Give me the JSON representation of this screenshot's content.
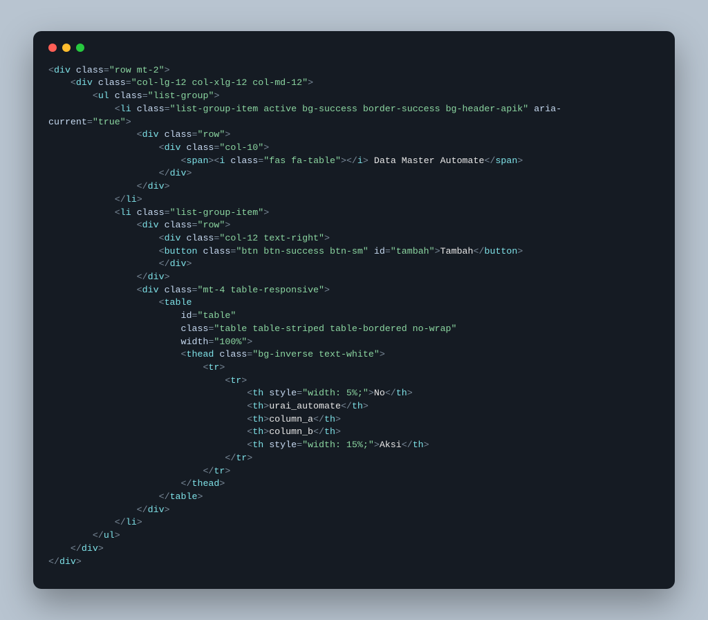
{
  "tokens": [
    {
      "indent": 0,
      "parts": [
        {
          "c": "p",
          "t": "<"
        },
        {
          "c": "t",
          "t": "div"
        },
        {
          "c": "p",
          "t": " "
        },
        {
          "c": "a",
          "t": "class"
        },
        {
          "c": "p",
          "t": "="
        },
        {
          "c": "s",
          "t": "\"row mt-2\""
        },
        {
          "c": "p",
          "t": ">"
        }
      ]
    },
    {
      "indent": 1,
      "parts": [
        {
          "c": "p",
          "t": "<"
        },
        {
          "c": "t",
          "t": "div"
        },
        {
          "c": "p",
          "t": " "
        },
        {
          "c": "a",
          "t": "class"
        },
        {
          "c": "p",
          "t": "="
        },
        {
          "c": "s",
          "t": "\"col-lg-12 col-xlg-12 col-md-12\""
        },
        {
          "c": "p",
          "t": ">"
        }
      ]
    },
    {
      "indent": 2,
      "parts": [
        {
          "c": "p",
          "t": "<"
        },
        {
          "c": "t",
          "t": "ul"
        },
        {
          "c": "p",
          "t": " "
        },
        {
          "c": "a",
          "t": "class"
        },
        {
          "c": "p",
          "t": "="
        },
        {
          "c": "s",
          "t": "\"list-group\""
        },
        {
          "c": "p",
          "t": ">"
        }
      ]
    },
    {
      "indent": 3,
      "parts": [
        {
          "c": "p",
          "t": "<"
        },
        {
          "c": "t",
          "t": "li"
        },
        {
          "c": "p",
          "t": " "
        },
        {
          "c": "a",
          "t": "class"
        },
        {
          "c": "p",
          "t": "="
        },
        {
          "c": "s",
          "t": "\"list-group-item active bg-success border-success bg-header-apik\""
        },
        {
          "c": "p",
          "t": " "
        },
        {
          "c": "a",
          "t": "aria-"
        }
      ],
      "wrap": true
    },
    {
      "indent": 0,
      "parts": [
        {
          "c": "a",
          "t": "current"
        },
        {
          "c": "p",
          "t": "="
        },
        {
          "c": "s",
          "t": "\"true\""
        },
        {
          "c": "p",
          "t": ">"
        }
      ]
    },
    {
      "indent": 4,
      "parts": [
        {
          "c": "p",
          "t": "<"
        },
        {
          "c": "t",
          "t": "div"
        },
        {
          "c": "p",
          "t": " "
        },
        {
          "c": "a",
          "t": "class"
        },
        {
          "c": "p",
          "t": "="
        },
        {
          "c": "s",
          "t": "\"row\""
        },
        {
          "c": "p",
          "t": ">"
        }
      ]
    },
    {
      "indent": 5,
      "parts": [
        {
          "c": "p",
          "t": "<"
        },
        {
          "c": "t",
          "t": "div"
        },
        {
          "c": "p",
          "t": " "
        },
        {
          "c": "a",
          "t": "class"
        },
        {
          "c": "p",
          "t": "="
        },
        {
          "c": "s",
          "t": "\"col-10\""
        },
        {
          "c": "p",
          "t": ">"
        }
      ]
    },
    {
      "indent": 6,
      "parts": [
        {
          "c": "p",
          "t": "<"
        },
        {
          "c": "t",
          "t": "span"
        },
        {
          "c": "p",
          "t": "><"
        },
        {
          "c": "t",
          "t": "i"
        },
        {
          "c": "p",
          "t": " "
        },
        {
          "c": "a",
          "t": "class"
        },
        {
          "c": "p",
          "t": "="
        },
        {
          "c": "s",
          "t": "\"fas fa-table\""
        },
        {
          "c": "p",
          "t": "></"
        },
        {
          "c": "t",
          "t": "i"
        },
        {
          "c": "p",
          "t": "> "
        },
        {
          "c": "tx",
          "t": "Data Master Automate"
        },
        {
          "c": "p",
          "t": "</"
        },
        {
          "c": "t",
          "t": "span"
        },
        {
          "c": "p",
          "t": ">"
        }
      ]
    },
    {
      "indent": 5,
      "parts": [
        {
          "c": "p",
          "t": "</"
        },
        {
          "c": "t",
          "t": "div"
        },
        {
          "c": "p",
          "t": ">"
        }
      ]
    },
    {
      "indent": 4,
      "parts": [
        {
          "c": "p",
          "t": "</"
        },
        {
          "c": "t",
          "t": "div"
        },
        {
          "c": "p",
          "t": ">"
        }
      ]
    },
    {
      "indent": 3,
      "parts": [
        {
          "c": "p",
          "t": "</"
        },
        {
          "c": "t",
          "t": "li"
        },
        {
          "c": "p",
          "t": ">"
        }
      ]
    },
    {
      "indent": 3,
      "parts": [
        {
          "c": "p",
          "t": "<"
        },
        {
          "c": "t",
          "t": "li"
        },
        {
          "c": "p",
          "t": " "
        },
        {
          "c": "a",
          "t": "class"
        },
        {
          "c": "p",
          "t": "="
        },
        {
          "c": "s",
          "t": "\"list-group-item\""
        },
        {
          "c": "p",
          "t": ">"
        }
      ]
    },
    {
      "indent": 4,
      "parts": [
        {
          "c": "p",
          "t": "<"
        },
        {
          "c": "t",
          "t": "div"
        },
        {
          "c": "p",
          "t": " "
        },
        {
          "c": "a",
          "t": "class"
        },
        {
          "c": "p",
          "t": "="
        },
        {
          "c": "s",
          "t": "\"row\""
        },
        {
          "c": "p",
          "t": ">"
        }
      ]
    },
    {
      "indent": 5,
      "parts": [
        {
          "c": "p",
          "t": "<"
        },
        {
          "c": "t",
          "t": "div"
        },
        {
          "c": "p",
          "t": " "
        },
        {
          "c": "a",
          "t": "class"
        },
        {
          "c": "p",
          "t": "="
        },
        {
          "c": "s",
          "t": "\"col-12 text-right\""
        },
        {
          "c": "p",
          "t": ">"
        }
      ]
    },
    {
      "indent": 5,
      "parts": [
        {
          "c": "p",
          "t": "<"
        },
        {
          "c": "t",
          "t": "button"
        },
        {
          "c": "p",
          "t": " "
        },
        {
          "c": "a",
          "t": "class"
        },
        {
          "c": "p",
          "t": "="
        },
        {
          "c": "s",
          "t": "\"btn btn-success btn-sm\""
        },
        {
          "c": "p",
          "t": " "
        },
        {
          "c": "a",
          "t": "id"
        },
        {
          "c": "p",
          "t": "="
        },
        {
          "c": "s",
          "t": "\"tambah\""
        },
        {
          "c": "p",
          "t": ">"
        },
        {
          "c": "tx",
          "t": "Tambah"
        },
        {
          "c": "p",
          "t": "</"
        },
        {
          "c": "t",
          "t": "button"
        },
        {
          "c": "p",
          "t": ">"
        }
      ]
    },
    {
      "indent": 5,
      "parts": [
        {
          "c": "p",
          "t": "</"
        },
        {
          "c": "t",
          "t": "div"
        },
        {
          "c": "p",
          "t": ">"
        }
      ]
    },
    {
      "indent": 4,
      "parts": [
        {
          "c": "p",
          "t": "</"
        },
        {
          "c": "t",
          "t": "div"
        },
        {
          "c": "p",
          "t": ">"
        }
      ]
    },
    {
      "indent": 4,
      "parts": [
        {
          "c": "p",
          "t": "<"
        },
        {
          "c": "t",
          "t": "div"
        },
        {
          "c": "p",
          "t": " "
        },
        {
          "c": "a",
          "t": "class"
        },
        {
          "c": "p",
          "t": "="
        },
        {
          "c": "s",
          "t": "\"mt-4 table-responsive\""
        },
        {
          "c": "p",
          "t": ">"
        }
      ]
    },
    {
      "indent": 5,
      "parts": [
        {
          "c": "p",
          "t": "<"
        },
        {
          "c": "t",
          "t": "table"
        }
      ]
    },
    {
      "indent": 6,
      "parts": [
        {
          "c": "a",
          "t": "id"
        },
        {
          "c": "p",
          "t": "="
        },
        {
          "c": "s",
          "t": "\"table\""
        }
      ]
    },
    {
      "indent": 6,
      "parts": [
        {
          "c": "a",
          "t": "class"
        },
        {
          "c": "p",
          "t": "="
        },
        {
          "c": "s",
          "t": "\"table table-striped table-bordered no-wrap\""
        }
      ]
    },
    {
      "indent": 6,
      "parts": [
        {
          "c": "a",
          "t": "width"
        },
        {
          "c": "p",
          "t": "="
        },
        {
          "c": "s",
          "t": "\"100%\""
        },
        {
          "c": "p",
          "t": ">"
        }
      ]
    },
    {
      "indent": 6,
      "parts": [
        {
          "c": "p",
          "t": "<"
        },
        {
          "c": "t",
          "t": "thead"
        },
        {
          "c": "p",
          "t": " "
        },
        {
          "c": "a",
          "t": "class"
        },
        {
          "c": "p",
          "t": "="
        },
        {
          "c": "s",
          "t": "\"bg-inverse text-white\""
        },
        {
          "c": "p",
          "t": ">"
        }
      ]
    },
    {
      "indent": 7,
      "parts": [
        {
          "c": "p",
          "t": "<"
        },
        {
          "c": "t",
          "t": "tr"
        },
        {
          "c": "p",
          "t": ">"
        }
      ]
    },
    {
      "indent": 8,
      "parts": [
        {
          "c": "p",
          "t": "<"
        },
        {
          "c": "t",
          "t": "tr"
        },
        {
          "c": "p",
          "t": ">"
        }
      ]
    },
    {
      "indent": 9,
      "parts": [
        {
          "c": "p",
          "t": "<"
        },
        {
          "c": "t",
          "t": "th"
        },
        {
          "c": "p",
          "t": " "
        },
        {
          "c": "a",
          "t": "style"
        },
        {
          "c": "p",
          "t": "="
        },
        {
          "c": "s",
          "t": "\"width: 5%;\""
        },
        {
          "c": "p",
          "t": ">"
        },
        {
          "c": "tx",
          "t": "No"
        },
        {
          "c": "p",
          "t": "</"
        },
        {
          "c": "t",
          "t": "th"
        },
        {
          "c": "p",
          "t": ">"
        }
      ]
    },
    {
      "indent": 9,
      "parts": [
        {
          "c": "p",
          "t": "<"
        },
        {
          "c": "t",
          "t": "th"
        },
        {
          "c": "p",
          "t": ">"
        },
        {
          "c": "tx",
          "t": "urai_automate"
        },
        {
          "c": "p",
          "t": "</"
        },
        {
          "c": "t",
          "t": "th"
        },
        {
          "c": "p",
          "t": ">"
        }
      ]
    },
    {
      "indent": 9,
      "parts": [
        {
          "c": "p",
          "t": "<"
        },
        {
          "c": "t",
          "t": "th"
        },
        {
          "c": "p",
          "t": ">"
        },
        {
          "c": "tx",
          "t": "column_a"
        },
        {
          "c": "p",
          "t": "</"
        },
        {
          "c": "t",
          "t": "th"
        },
        {
          "c": "p",
          "t": ">"
        }
      ]
    },
    {
      "indent": 9,
      "parts": [
        {
          "c": "p",
          "t": "<"
        },
        {
          "c": "t",
          "t": "th"
        },
        {
          "c": "p",
          "t": ">"
        },
        {
          "c": "tx",
          "t": "column_b"
        },
        {
          "c": "p",
          "t": "</"
        },
        {
          "c": "t",
          "t": "th"
        },
        {
          "c": "p",
          "t": ">"
        }
      ]
    },
    {
      "indent": 9,
      "parts": [
        {
          "c": "p",
          "t": "<"
        },
        {
          "c": "t",
          "t": "th"
        },
        {
          "c": "p",
          "t": " "
        },
        {
          "c": "a",
          "t": "style"
        },
        {
          "c": "p",
          "t": "="
        },
        {
          "c": "s",
          "t": "\"width: 15%;\""
        },
        {
          "c": "p",
          "t": ">"
        },
        {
          "c": "tx",
          "t": "Aksi"
        },
        {
          "c": "p",
          "t": "</"
        },
        {
          "c": "t",
          "t": "th"
        },
        {
          "c": "p",
          "t": ">"
        }
      ]
    },
    {
      "indent": 8,
      "parts": [
        {
          "c": "p",
          "t": "</"
        },
        {
          "c": "t",
          "t": "tr"
        },
        {
          "c": "p",
          "t": ">"
        }
      ]
    },
    {
      "indent": 7,
      "parts": [
        {
          "c": "p",
          "t": "</"
        },
        {
          "c": "t",
          "t": "tr"
        },
        {
          "c": "p",
          "t": ">"
        }
      ]
    },
    {
      "indent": 6,
      "parts": [
        {
          "c": "p",
          "t": "</"
        },
        {
          "c": "t",
          "t": "thead"
        },
        {
          "c": "p",
          "t": ">"
        }
      ]
    },
    {
      "indent": 5,
      "parts": [
        {
          "c": "p",
          "t": "</"
        },
        {
          "c": "t",
          "t": "table"
        },
        {
          "c": "p",
          "t": ">"
        }
      ]
    },
    {
      "indent": 4,
      "parts": [
        {
          "c": "p",
          "t": "</"
        },
        {
          "c": "t",
          "t": "div"
        },
        {
          "c": "p",
          "t": ">"
        }
      ]
    },
    {
      "indent": 3,
      "parts": [
        {
          "c": "p",
          "t": "</"
        },
        {
          "c": "t",
          "t": "li"
        },
        {
          "c": "p",
          "t": ">"
        }
      ]
    },
    {
      "indent": 2,
      "parts": [
        {
          "c": "p",
          "t": "</"
        },
        {
          "c": "t",
          "t": "ul"
        },
        {
          "c": "p",
          "t": ">"
        }
      ]
    },
    {
      "indent": 1,
      "parts": [
        {
          "c": "p",
          "t": "</"
        },
        {
          "c": "t",
          "t": "div"
        },
        {
          "c": "p",
          "t": ">"
        }
      ]
    },
    {
      "indent": 0,
      "parts": [
        {
          "c": "p",
          "t": "</"
        },
        {
          "c": "t",
          "t": "div"
        },
        {
          "c": "p",
          "t": ">"
        }
      ]
    }
  ]
}
